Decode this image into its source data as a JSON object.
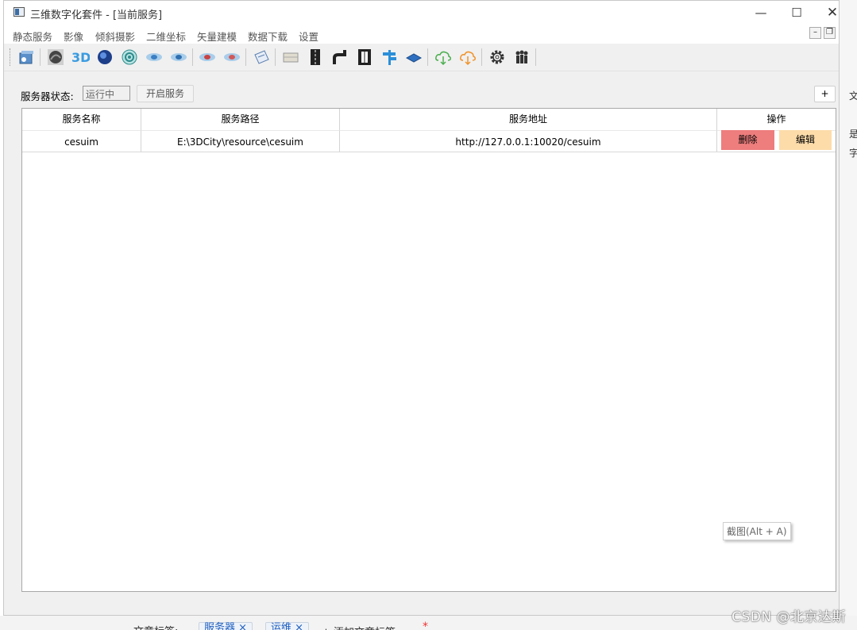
{
  "window": {
    "title": "三维数字化套件 - [当前服务]",
    "controls": {
      "minimize": "—",
      "maximize": "☐",
      "close": "✕"
    }
  },
  "menu": {
    "items": [
      "静态服务",
      "影像",
      "倾斜摄影",
      "二维坐标",
      "矢量建模",
      "数据下载",
      "设置"
    ],
    "mdi": {
      "minimize": "–",
      "restore": "❐",
      "close": "✕"
    }
  },
  "toolbar": {
    "buttons": [
      {
        "icon": "map-cube-icon"
      },
      {
        "icon": "terrain-icon"
      },
      {
        "icon": "3d-text-icon",
        "text": "3D"
      },
      {
        "icon": "globe-icon"
      },
      {
        "icon": "target-globe-icon"
      },
      {
        "icon": "layer-eye-icon"
      },
      {
        "icon": "layer-eye-blue-icon"
      },
      {
        "icon": "layer-eye-red-icon"
      },
      {
        "icon": "layer-eye-red2-icon"
      },
      {
        "icon": "document-icon"
      },
      {
        "icon": "wall-icon"
      },
      {
        "icon": "road-icon"
      },
      {
        "icon": "curve-road-icon"
      },
      {
        "icon": "film-road-icon"
      },
      {
        "icon": "signpost-icon"
      },
      {
        "icon": "tile-icon"
      },
      {
        "icon": "cloud-download-green-icon"
      },
      {
        "icon": "cloud-download-orange-icon"
      },
      {
        "icon": "gear-icon"
      },
      {
        "icon": "people-icon"
      }
    ]
  },
  "server": {
    "status_label": "服务器状态:",
    "status_value": "运行中",
    "start_button": "开启服务",
    "add_button": "+"
  },
  "table": {
    "headers": [
      "服务名称",
      "服务路径",
      "服务地址",
      "操作"
    ],
    "rows": [
      {
        "name": "cesuim",
        "path": "E:\\3DCity\\resource\\cesuim",
        "address": "http://127.0.0.1:10020/cesuim",
        "delete": "删除",
        "edit": "编辑"
      }
    ]
  },
  "tooltip": "截图(Alt + A)",
  "background": {
    "right_fragments": [
      "文",
      "是",
      "字"
    ],
    "bottom_label": "文章标签:",
    "bottom_tags": [
      "服务器 ×",
      "运维 ×"
    ],
    "bottom_add": "+ 添加文章标签",
    "bottom_star": "*",
    "watermark": "CSDN @北京达斯"
  },
  "colors": {
    "delete": "#ee7d7d",
    "edit": "#fddcaa",
    "window_bg": "#f0f0f0",
    "table_bg": "#ffffff"
  }
}
